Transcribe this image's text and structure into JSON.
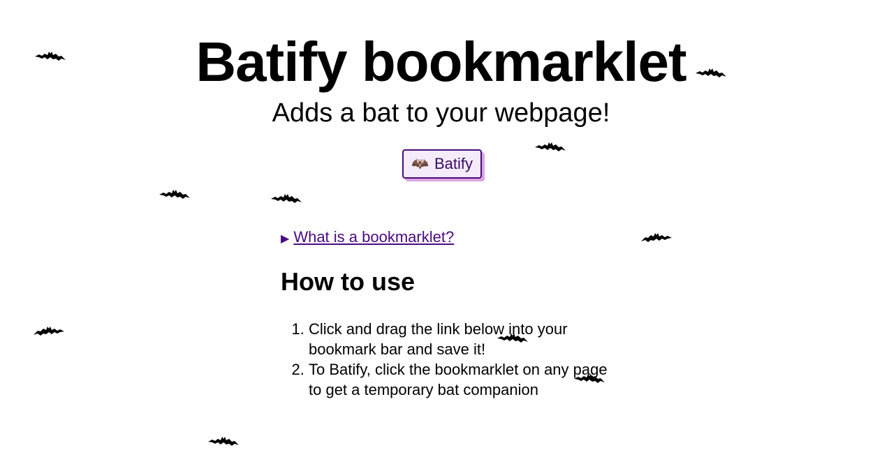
{
  "header": {
    "title": "Batify bookmarklet",
    "subtitle": "Adds a bat to your webpage!"
  },
  "bookmarklet": {
    "emoji": "🦇",
    "label": "Batify"
  },
  "details": {
    "marker": "▶",
    "summary": "What is a bookmarklet?"
  },
  "howto": {
    "heading": "How to use",
    "steps": [
      "Click and drag the link below into your bookmark bar and save it!",
      "To Batify, click the bookmarklet on any page to get a temporary bat companion"
    ]
  },
  "colors": {
    "link": "#4a0a80",
    "button_border": "#4b0a7a",
    "button_bg": "#f4ecfb",
    "button_shadow": "#d7a6e0",
    "bat": "#000000"
  }
}
